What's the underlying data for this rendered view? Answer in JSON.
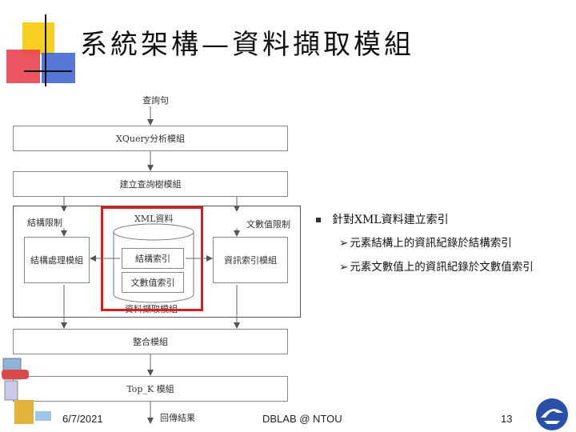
{
  "slide": {
    "title": "系統架構—資料擷取模組",
    "footer_date": "6/7/2021",
    "footer_center": "DBLAB @ NTOU",
    "page_number": "13"
  },
  "diagram": {
    "query_label": "查詢句",
    "xquery_module": "XQuery分析模組",
    "build_tree_module": "建立查詢樹模組",
    "structure_limit": "結構限制",
    "xml_data": "XML資料",
    "text_value_limit": "文數值限制",
    "structure_process_module": "結構處理模組",
    "structure_index": "結構索引",
    "text_value_index": "文數值索引",
    "info_index_module": "資訊索引模組",
    "data_fetch_module": "資料擷取模組",
    "integration_module": "整合模組",
    "topk_module": "Top_K 模組",
    "return_result": "回傳結果"
  },
  "bullets": {
    "main": "針對XML資料建立索引",
    "sub1": "元素結構上的資訊紀錄於結構索引",
    "sub2": "元素文數值上的資訊紀錄於文數值索引"
  },
  "colors": {
    "highlight": "#d81e1e"
  }
}
